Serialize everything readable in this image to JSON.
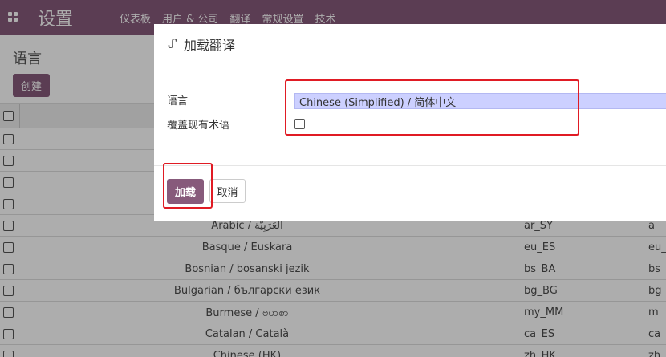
{
  "navbar": {
    "app_title": "设置",
    "menu": [
      "仪表板",
      "用户 & 公司",
      "翻译",
      "常规设置",
      "技术"
    ],
    "color": "#875a7b"
  },
  "control": {
    "breadcrumb": "语言",
    "create_label": "创建"
  },
  "list": {
    "rows": [
      {
        "name": "",
        "code": "",
        "cut": ""
      },
      {
        "name": "",
        "code": "",
        "cut": ""
      },
      {
        "name": "",
        "code": "",
        "cut": ""
      },
      {
        "name": "",
        "code": "",
        "cut": ""
      },
      {
        "name": "Arabic / العَرَبِيَّة",
        "code": "ar_SY",
        "cut": "a"
      },
      {
        "name": "Basque / Euskara",
        "code": "eu_ES",
        "cut": "eu_"
      },
      {
        "name": "Bosnian / bosanski jezik",
        "code": "bs_BA",
        "cut": "bs"
      },
      {
        "name": "Bulgarian / български език",
        "code": "bg_BG",
        "cut": "bg"
      },
      {
        "name": "Burmese / ဗမာစာ",
        "code": "my_MM",
        "cut": "m"
      },
      {
        "name": "Catalan / Català",
        "code": "ca_ES",
        "cut": "ca_"
      },
      {
        "name": "Chinese (HK)",
        "code": "zh_HK",
        "cut": "zh"
      }
    ]
  },
  "modal": {
    "title": "加载翻译",
    "language_label": "语言",
    "language_value": "Chinese (Simplified) / 简体中文",
    "overwrite_label": "覆盖现有术语",
    "load_label": "加载",
    "cancel_label": "取消"
  },
  "colors": {
    "primary": "#875a7b",
    "highlight": "#e01b24",
    "selected_field": "#ccd0ff"
  }
}
